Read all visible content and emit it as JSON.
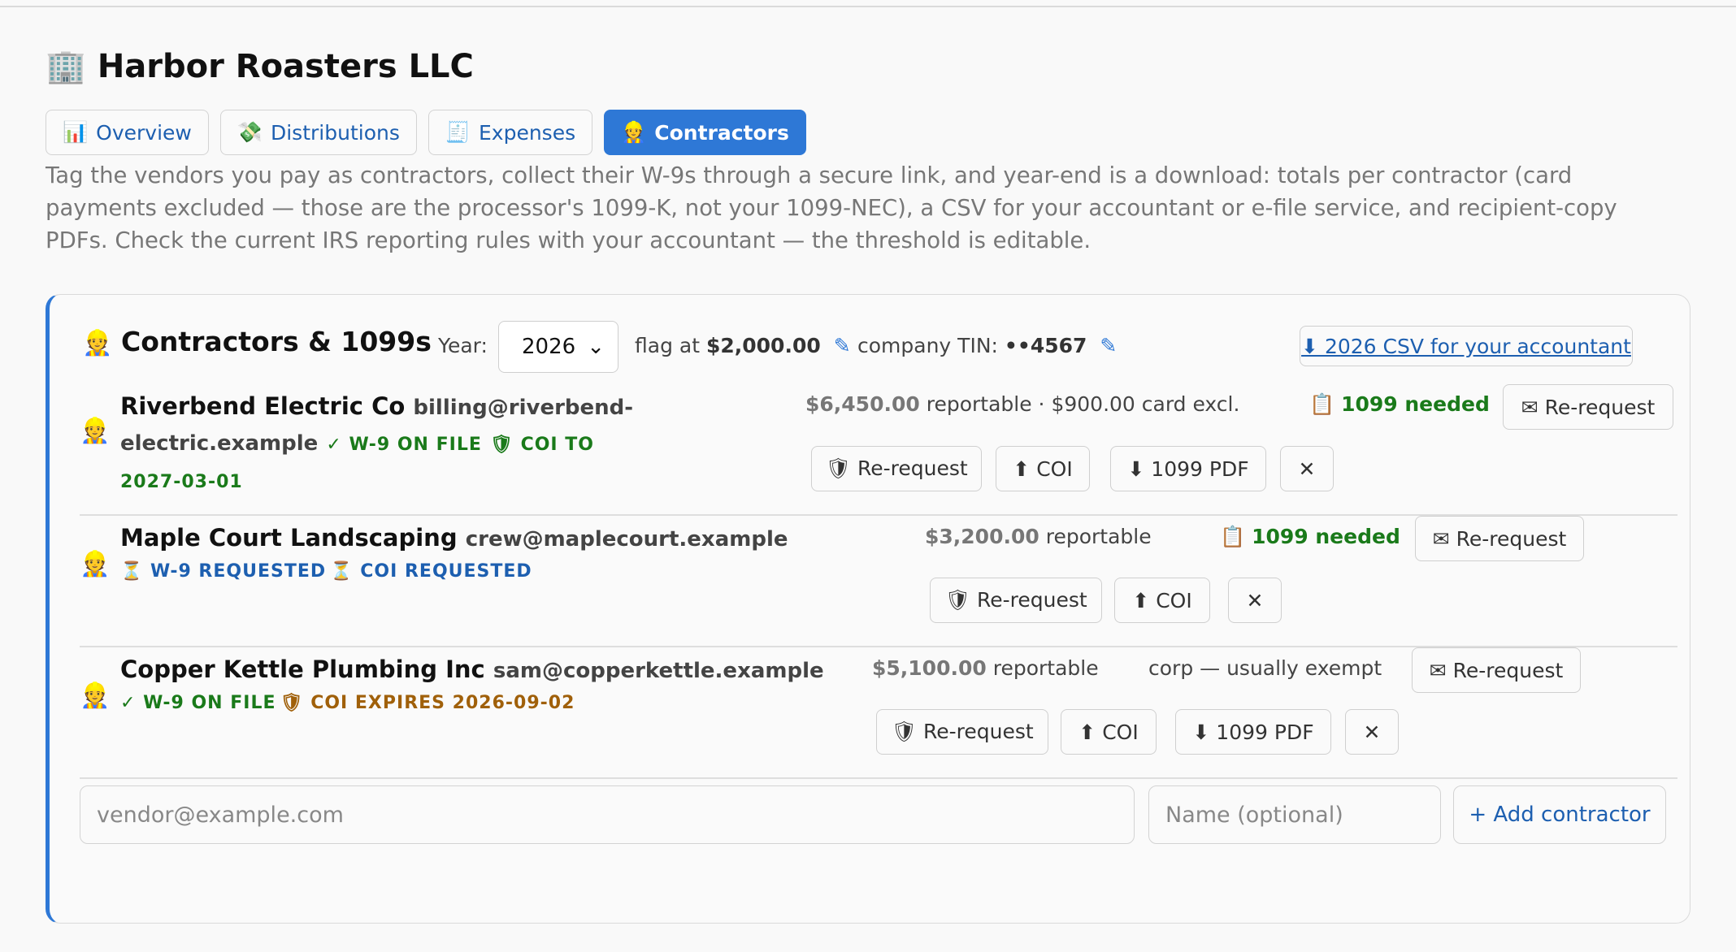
{
  "header": {
    "icon": "🏢",
    "title": "Harbor Roasters LLC"
  },
  "tabs": [
    {
      "icon": "📊",
      "label": "Overview",
      "active": false
    },
    {
      "icon": "💸",
      "label": "Distributions",
      "active": false
    },
    {
      "icon": "🧾",
      "label": "Expenses",
      "active": false
    },
    {
      "icon": "👷",
      "label": "Contractors",
      "active": true
    }
  ],
  "intro": "Tag the vendors you pay as contractors, collect their W-9s through a secure link, and year-end is a download: totals per contractor (card payments excluded — those are the processor's 1099-K, not your 1099-NEC), a CSV for your accountant or e-file service, and recipient-copy PDFs. Check the current IRS reporting rules with your accountant — the threshold is editable.",
  "panel": {
    "icon": "👷",
    "title": "Contractors & 1099s",
    "year_label": "Year:",
    "year_value": "2026",
    "select_chevron": "⌄",
    "flag_label": "flag at",
    "flag_value": "$2,000.00",
    "tin_label": "company TIN:",
    "tin_value": "••4567",
    "edit_icon": "✎",
    "csv_button": "⬇ 2026 CSV for your accountant"
  },
  "contractors": [
    {
      "icon": "👷",
      "name": "Riverbend Electric Co",
      "email": "billing@riverbend-electric.example",
      "w9_status": "✓ W-9 ON FILE",
      "coi_status": "🛡 COI TO 2027-03-01",
      "amount": "$6,450.00",
      "amount_suffix": "reportable",
      "note": "· $900.00 card excl.",
      "needed_icon": "📋",
      "needed": "1099 needed",
      "rerequest_w9": "✉ Re-request",
      "rerequest_coi": "🛡 Re-request",
      "coi_button": "⬆ COI",
      "pdf_button": "⬇ 1099 PDF",
      "remove_button": "✕"
    },
    {
      "icon": "👷",
      "name": "Maple Court Landscaping",
      "email": "crew@maplecourt.example",
      "w9_status": "⏳ W-9 REQUESTED",
      "coi_status": "⏳ COI REQUESTED",
      "amount": "$3,200.00",
      "amount_suffix": "reportable",
      "needed_icon": "📋",
      "needed": "1099 needed",
      "rerequest_w9": "✉ Re-request",
      "rerequest_coi": "🛡 Re-request",
      "coi_button": "⬆ COI",
      "remove_button": "✕"
    },
    {
      "icon": "👷",
      "name": "Copper Kettle Plumbing Inc",
      "email": "sam@copperkettle.example",
      "w9_status": "✓ W-9 ON FILE",
      "coi_status": "🛡 COI EXPIRES 2026-09-02",
      "amount": "$5,100.00",
      "amount_suffix": "reportable",
      "exempt": "corp — usually exempt",
      "rerequest_w9": "✉ Re-request",
      "rerequest_coi": "🛡 Re-request",
      "coi_button": "⬆ COI",
      "pdf_button": "⬇ 1099 PDF",
      "remove_button": "✕"
    }
  ],
  "add_form": {
    "email_placeholder": "vendor@example.com",
    "name_placeholder": "Name (optional)",
    "add_button": "+ Add contractor"
  }
}
